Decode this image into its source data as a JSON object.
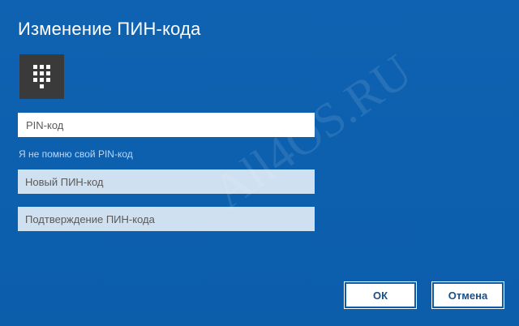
{
  "dialog": {
    "title": "Изменение ПИН-кода",
    "tile_icon": "keypad-icon",
    "watermark": "All4OS.RU"
  },
  "form": {
    "pin_placeholder": "PIN-код",
    "forgot_link": "Я не помню свой PIN-код",
    "new_pin_placeholder": "Новый ПИН-код",
    "confirm_pin_placeholder": "Подтверждение ПИН-кода"
  },
  "buttons": {
    "ok_label": "ОК",
    "cancel_label": "Отмена"
  },
  "colors": {
    "background": "#0e62b1",
    "tile": "#3a3a3a",
    "inactive_field": "#cfe0f1",
    "link": "#b9d6f4"
  }
}
